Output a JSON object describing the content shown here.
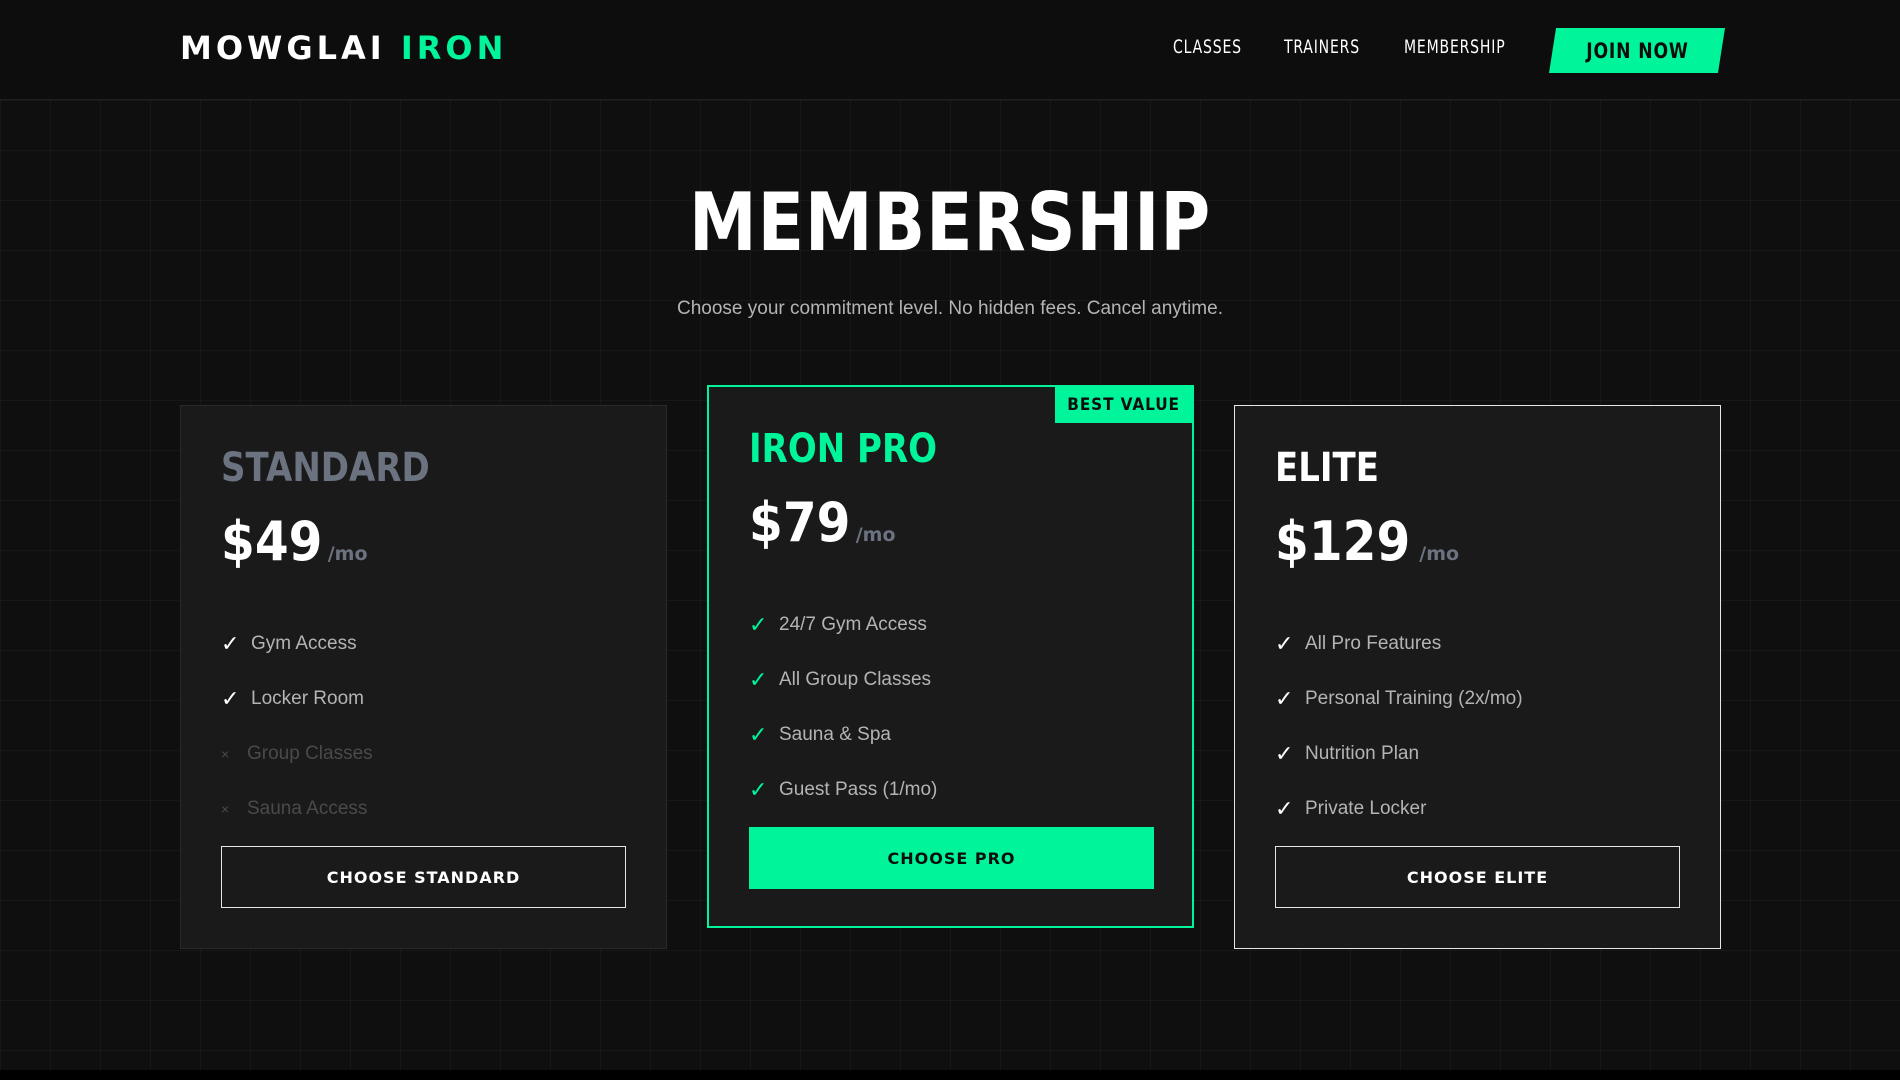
{
  "brand": {
    "name": "MOWGLAI",
    "accent": "IRON"
  },
  "nav": {
    "classes": "CLASSES",
    "trainers": "TRAINERS",
    "membership": "MEMBERSHIP",
    "cta": "JOIN NOW"
  },
  "hero": {
    "title": "MEMBERSHIP",
    "subtitle": "Choose your commitment level. No hidden fees. Cancel anytime."
  },
  "plans": [
    {
      "name": "STANDARD",
      "price": "$49",
      "unit": "/mo",
      "features": [
        {
          "label": "Gym Access",
          "included": true
        },
        {
          "label": "Locker Room",
          "included": true
        },
        {
          "label": "Group Classes",
          "included": false
        },
        {
          "label": "Sauna Access",
          "included": false
        }
      ],
      "button": "CHOOSE STANDARD"
    },
    {
      "name": "IRON PRO",
      "price": "$79",
      "unit": "/mo",
      "badge": "BEST VALUE",
      "features": [
        {
          "label": "24/7 Gym Access",
          "included": true
        },
        {
          "label": "All Group Classes",
          "included": true
        },
        {
          "label": "Sauna & Spa",
          "included": true
        },
        {
          "label": "Guest Pass (1/mo)",
          "included": true
        }
      ],
      "button": "CHOOSE PRO"
    },
    {
      "name": "ELITE",
      "price": "$129",
      "unit": "/mo",
      "features": [
        {
          "label": "All Pro Features",
          "included": true
        },
        {
          "label": "Personal Training (2x/mo)",
          "included": true
        },
        {
          "label": "Nutrition Plan",
          "included": true
        },
        {
          "label": "Private Locker",
          "included": true
        }
      ],
      "button": "CHOOSE ELITE"
    }
  ],
  "icons": {
    "check": "check-icon",
    "cross": "cross-icon"
  },
  "marks": {
    "check": "✓",
    "cross": "×"
  },
  "colors": {
    "accent": "#00f59a",
    "background": "#0d0d0d",
    "card": "#1a1a1a",
    "muted": "#6b7280"
  }
}
